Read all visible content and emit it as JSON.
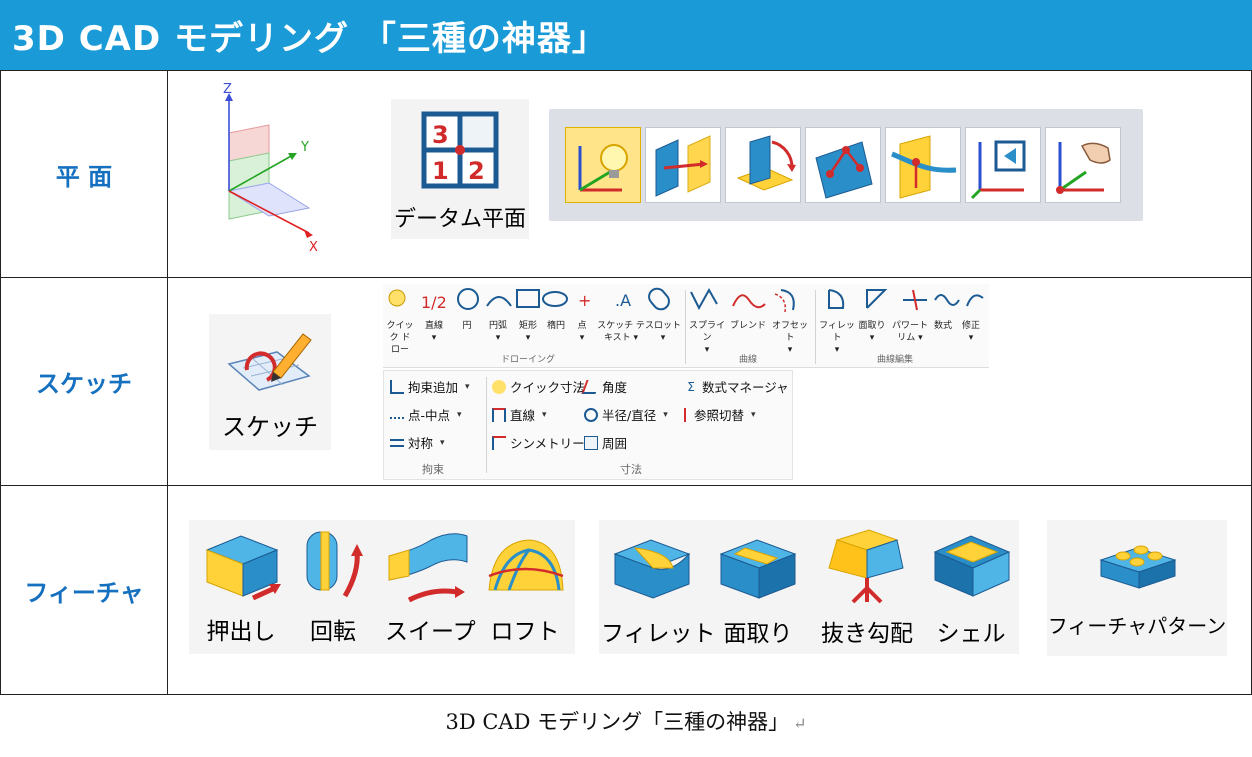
{
  "banner": {
    "title": "3D CAD モデリング 「三種の神器」"
  },
  "rows": {
    "plane": {
      "heading": "平 面",
      "axes": {
        "x": "X",
        "y": "Y",
        "z": "Z"
      },
      "datum": {
        "label": "データム平面",
        "digits": [
          "3",
          "1",
          "2"
        ]
      }
    },
    "sketch": {
      "heading": "スケッチ",
      "icon_label": "スケッチ",
      "ribbon": {
        "buttons": [
          {
            "label": "クイック ド\nロー",
            "dropdown": false
          },
          {
            "label": "直線",
            "dropdown": true
          },
          {
            "label": "円",
            "dropdown": false
          },
          {
            "label": "円弧",
            "dropdown": true
          },
          {
            "label": "矩形",
            "dropdown": true
          },
          {
            "label": "楕円",
            "dropdown": false
          },
          {
            "label": "点",
            "dropdown": true
          },
          {
            "label": "スケッチ テ\nキスト",
            "dropdown": true
          },
          {
            "label": "スロット",
            "dropdown": true
          },
          {
            "label": "スプライン",
            "dropdown": true
          },
          {
            "label": "ブレンド",
            "dropdown": false
          },
          {
            "label": "オフセット",
            "dropdown": true
          },
          {
            "label": "フィレット",
            "dropdown": true
          },
          {
            "label": "面取り",
            "dropdown": true
          },
          {
            "label": "パワート\nリム",
            "dropdown": true
          },
          {
            "label": "数式",
            "dropdown": false
          },
          {
            "label": "修正",
            "dropdown": true
          }
        ],
        "groups": [
          "ドローイング",
          "曲線",
          "曲線編集"
        ]
      },
      "constraints": {
        "items": [
          "拘束追加",
          "点-中点",
          "対称"
        ],
        "group": "拘束"
      },
      "dimensions": {
        "items": [
          "クイック寸法",
          "角度",
          "数式マネージャ",
          "直線",
          "半径/直径",
          "参照切替",
          "シンメトリー",
          "周囲"
        ],
        "group": "寸法"
      }
    },
    "feature": {
      "heading": "フィーチャ",
      "items": [
        "押出し",
        "回転",
        "スイープ",
        "ロフト",
        "フィレット",
        "面取り",
        "抜き勾配",
        "シェル",
        "フィーチャパターン"
      ]
    }
  },
  "caption": {
    "text": "3D CAD モデリング「三種の神器」",
    "return_mark": "↵"
  },
  "colors": {
    "banner": "#1a9bd7",
    "heading": "#1570c0",
    "accent_yellow": "#ffd23a",
    "accent_blue": "#2a8fc8",
    "arrow_red": "#d22b2b"
  }
}
